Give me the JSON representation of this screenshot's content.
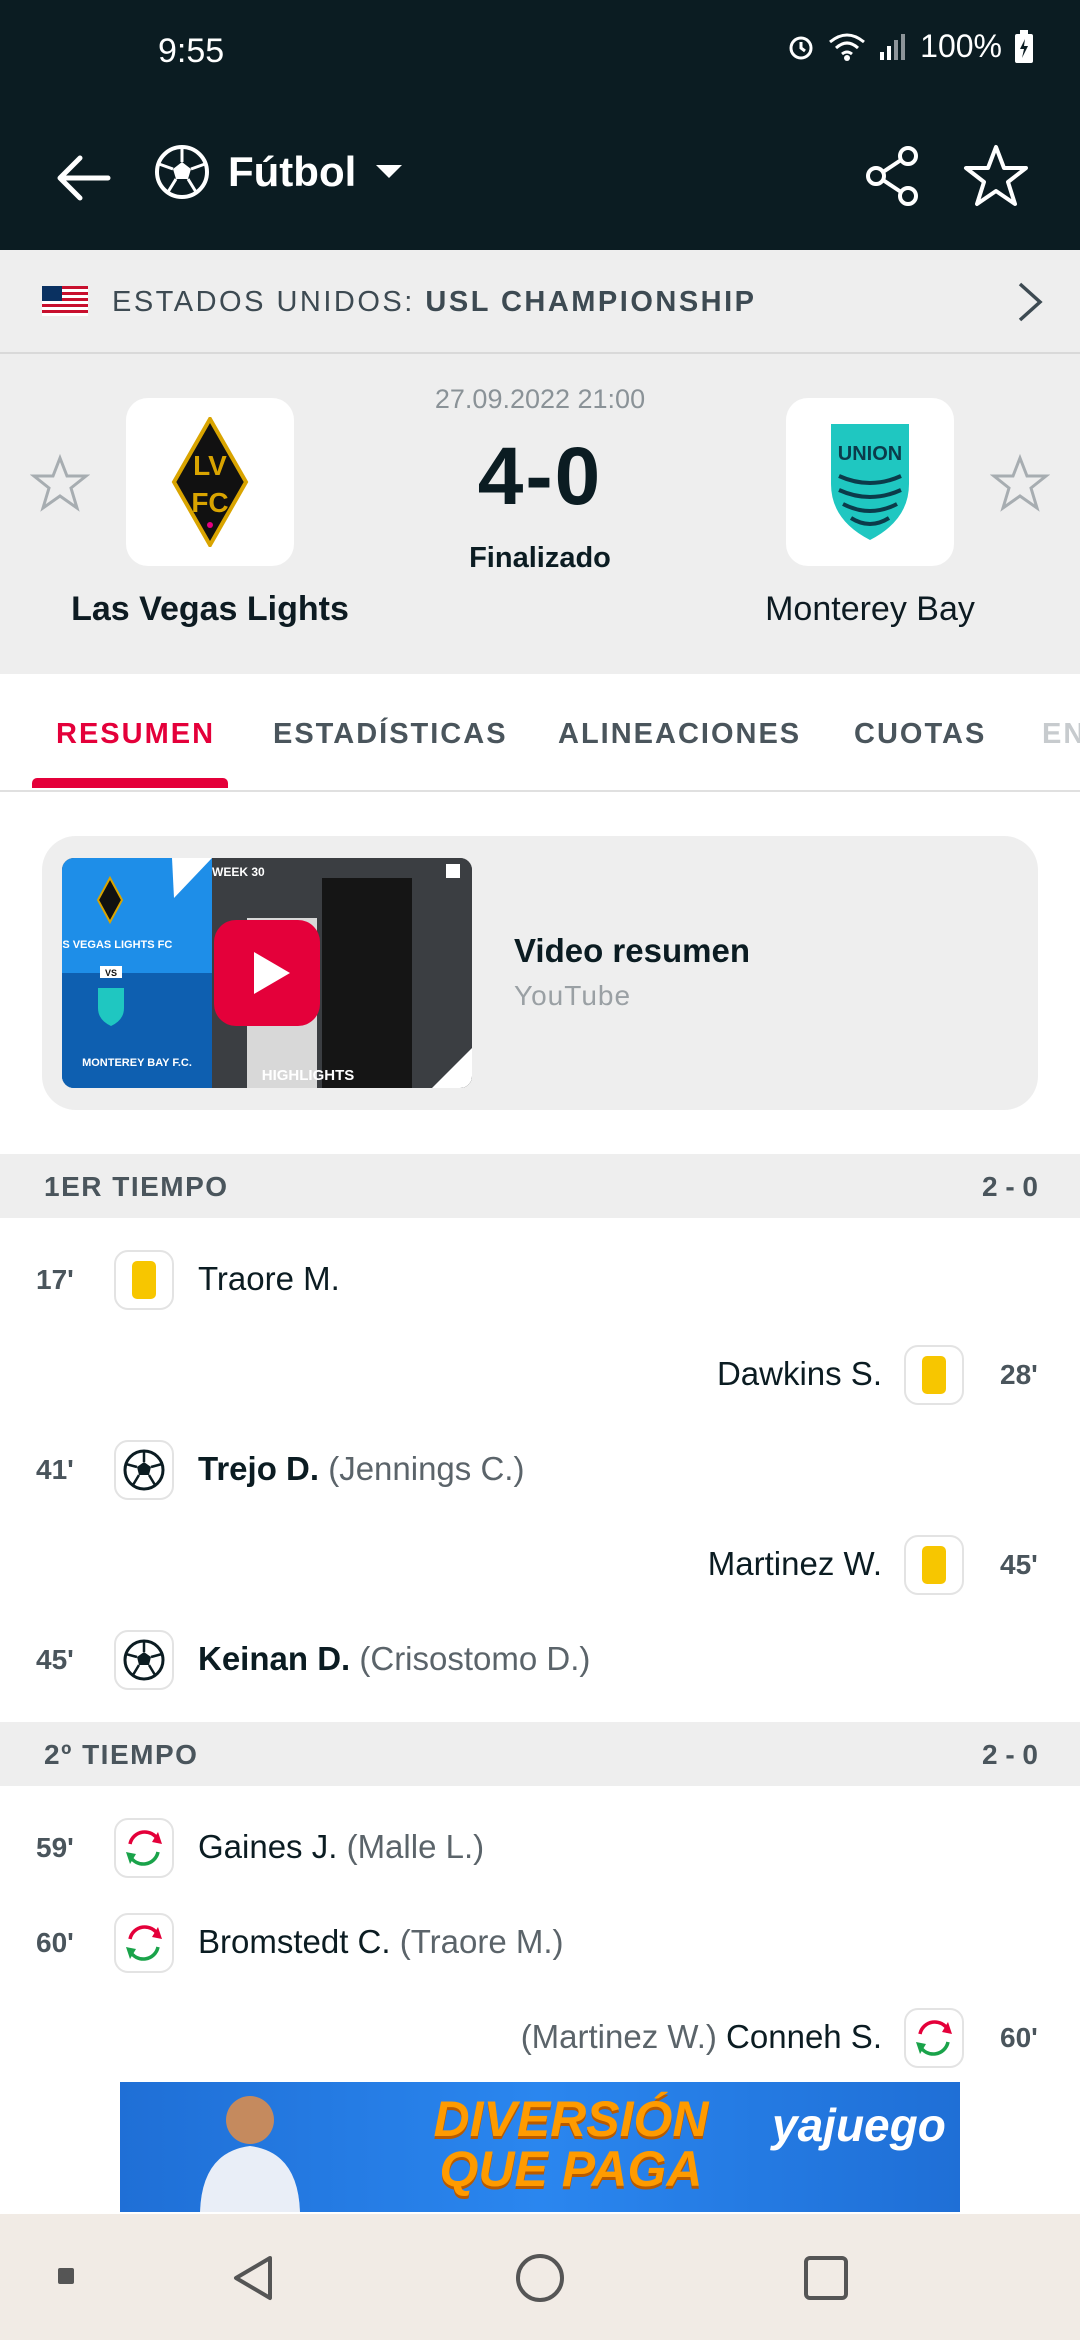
{
  "status_bar": {
    "time": "9:55",
    "battery": "100%"
  },
  "topbar": {
    "sport_label": "Fútbol"
  },
  "league": {
    "country": "ESTADOS UNIDOS:",
    "competition": "USL CHAMPIONSHIP"
  },
  "match": {
    "datetime": "27.09.2022 21:00",
    "score": "4-0",
    "status": "Finalizado",
    "home_team": "Las Vegas Lights",
    "away_team": "Monterey Bay",
    "home_logo_text": "LV Lights FC",
    "away_logo_text": "UNION"
  },
  "tabs": [
    "RESUMEN",
    "ESTADÍSTICAS",
    "ALINEACIONES",
    "CUOTAS",
    "EN"
  ],
  "video": {
    "title": "Video resumen",
    "source": "YouTube",
    "thumb_week": "WEEK 30",
    "thumb_home": "LAS VEGAS LIGHTS FC",
    "thumb_vs": "VS",
    "thumb_away": "MONTEREY BAY F.C.",
    "thumb_tag": "HIGHLIGHTS"
  },
  "half1": {
    "label": "1ER TIEMPO",
    "score": "2 - 0"
  },
  "half2": {
    "label": "2º TIEMPO",
    "score": "2 - 0"
  },
  "events1": [
    {
      "minute": "17'",
      "player": "Traore M.",
      "assist": ""
    },
    {
      "minute": "28'",
      "player": "Dawkins S.",
      "assist": ""
    },
    {
      "minute": "41'",
      "player": "Trejo D.",
      "assist": "(Jennings C.)"
    },
    {
      "minute": "45'",
      "player": "Martinez W.",
      "assist": ""
    },
    {
      "minute": "45'",
      "player": "Keinan D.",
      "assist": "(Crisostomo D.)"
    }
  ],
  "events2": [
    {
      "minute": "59'",
      "player": "Gaines J.",
      "assist": "(Malle L.)"
    },
    {
      "minute": "60'",
      "player": "Bromstedt C.",
      "assist": "(Traore M.)"
    },
    {
      "minute": "60'",
      "player": "Conneh S.",
      "assist": "(Martinez W.)"
    }
  ],
  "ad": {
    "headline": "DIVERSIÓN QUE PAGA",
    "brand": "yajuego"
  },
  "colors": {
    "accent": "#e4003a",
    "header_bg": "#0b1c22",
    "yellow_card": "#f7c600"
  }
}
